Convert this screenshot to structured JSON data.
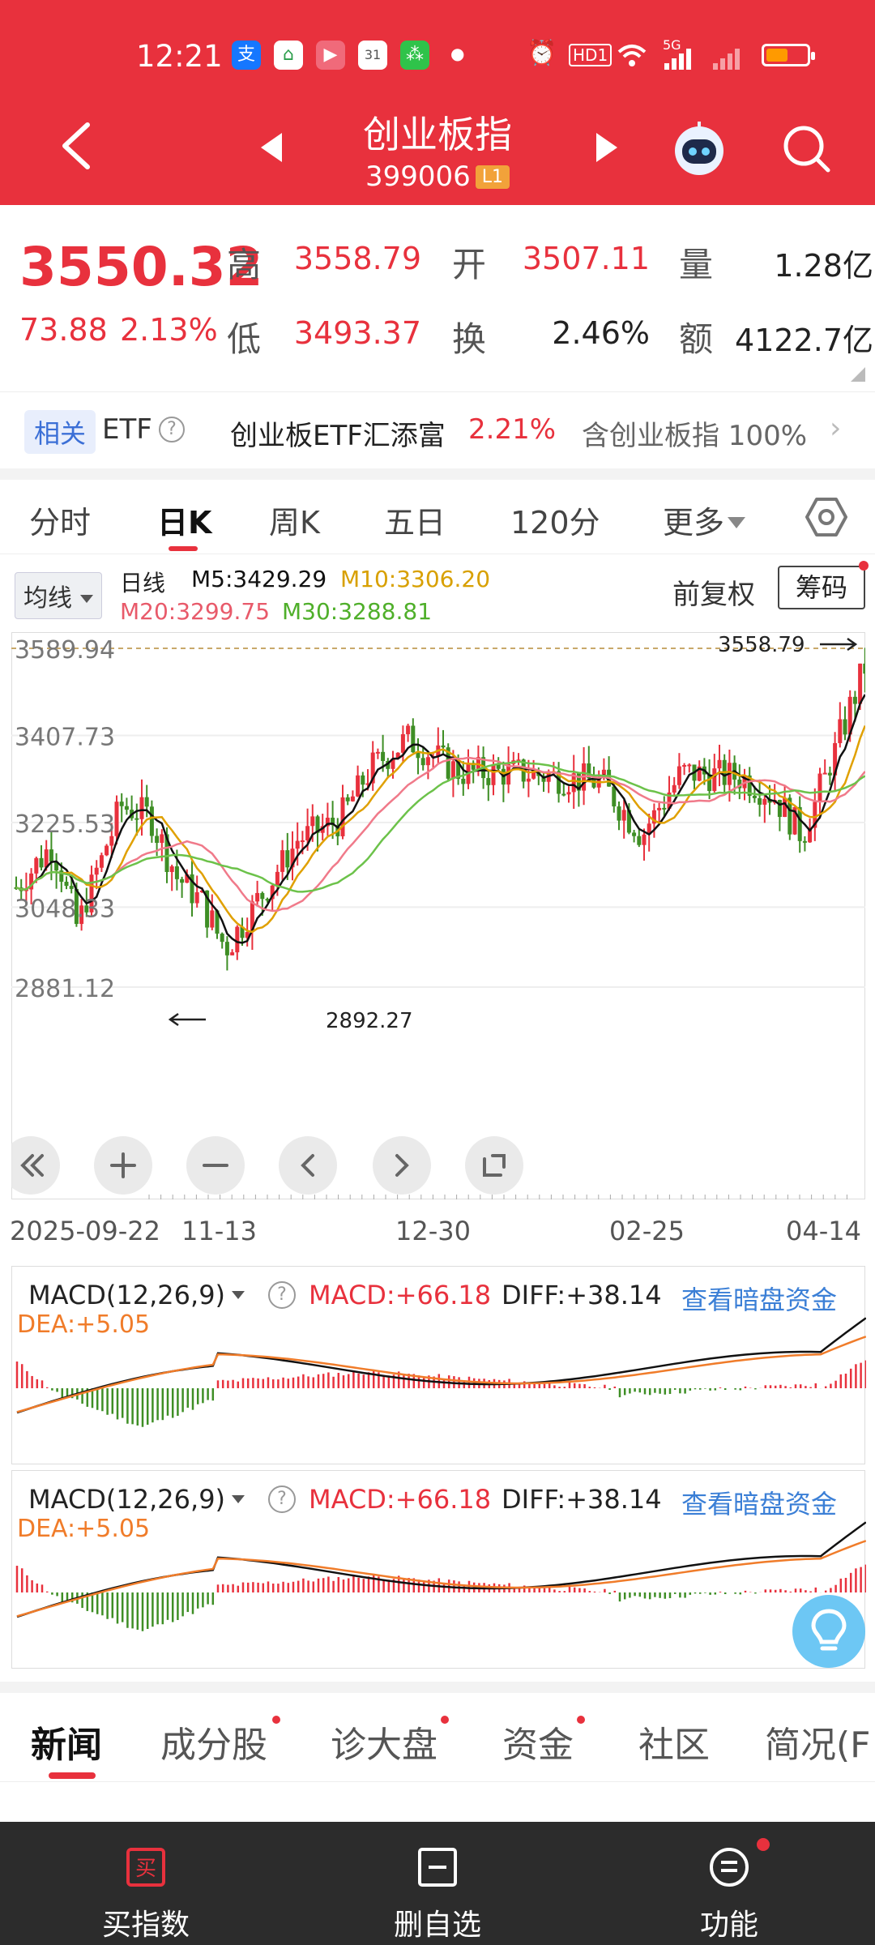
{
  "status_bar": {
    "time": "12:21",
    "app_icons": [
      "alipay-icon",
      "app-icon",
      "video-icon",
      "calendar-icon",
      "app-icon"
    ],
    "network": "5G",
    "hd_label": "HD1"
  },
  "nav": {
    "title": "创业板指",
    "code": "399006",
    "level": "L1"
  },
  "quote": {
    "price": "3550.32",
    "change": "73.88",
    "change_pct": "2.13%",
    "labels": {
      "high": "高",
      "low": "低",
      "open": "开",
      "turnover_rate": "换",
      "volume": "量",
      "amount": "额"
    },
    "high": "3558.79",
    "low": "3493.37",
    "open": "3507.11",
    "turnover_rate": "2.46%",
    "volume": "1.28亿",
    "amount": "4122.7亿"
  },
  "etf": {
    "tag": "相关",
    "word": "ETF",
    "name": "创业板ETF汇添富",
    "change": "2.21%",
    "contains": "含创业板指 100%"
  },
  "period_tabs": [
    {
      "label": "分时"
    },
    {
      "label": "日K"
    },
    {
      "label": "周K"
    },
    {
      "label": "五日"
    },
    {
      "label": "120分"
    },
    {
      "label": "更多"
    }
  ],
  "legend": {
    "ma_select": "均线",
    "period": "日线",
    "m5": "M5:3429.29",
    "m10": "M10:3306.20",
    "m20": "M20:3299.75",
    "m30": "M30:3288.81",
    "adjust": "前复权",
    "chips": "筹码"
  },
  "chart": {
    "y_ticks": [
      "3589.94",
      "3407.73",
      "3225.53",
      "3048.33",
      "2881.12"
    ],
    "y_values": [
      3589.94,
      3407.73,
      3225.53,
      3048.33,
      2881.12
    ],
    "high_marker": "3558.79",
    "low_marker": "2892.27",
    "dates": [
      "2025-09-22",
      "11-13",
      "12-30",
      "02-25",
      "04-14"
    ],
    "colors": {
      "up": "#e8313d",
      "down": "#3e8e25",
      "m5": "#111111",
      "m10": "#e0a000",
      "m20": "#f07a8a",
      "m30": "#6cc24a"
    }
  },
  "macd": [
    {
      "selector": "MACD(12,26,9)",
      "macd": "MACD:+66.18",
      "diff": "DIFF:+38.14",
      "dea": "DEA:+5.05",
      "link": "查看暗盘资金"
    },
    {
      "selector": "MACD(12,26,9)",
      "macd": "MACD:+66.18",
      "diff": "DIFF:+38.14",
      "dea": "DEA:+5.05",
      "link": "查看暗盘资金"
    }
  ],
  "bottom_tabs": [
    {
      "label": "新闻"
    },
    {
      "label": "成分股"
    },
    {
      "label": "诊大盘"
    },
    {
      "label": "资金"
    },
    {
      "label": "社区"
    },
    {
      "label": "简况(F"
    }
  ],
  "actions": [
    {
      "label": "买指数",
      "icon": "buy-icon",
      "icon_text": "买"
    },
    {
      "label": "删自选",
      "icon": "remove-watchlist-icon"
    },
    {
      "label": "功能",
      "icon": "menu-icon"
    }
  ]
}
